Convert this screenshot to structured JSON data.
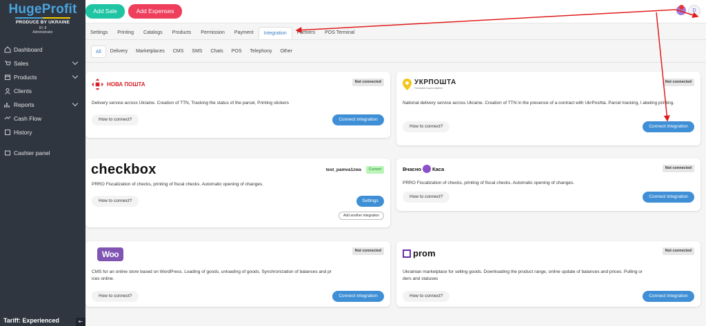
{
  "sidebar": {
    "logo": "HugeProfit",
    "tagline": "PRODUCE BY UKRAINE",
    "id": "ID: 8",
    "role": "Administrator",
    "items": [
      {
        "label": "Dashboard",
        "icon": "dashboard-icon"
      },
      {
        "label": "Sales",
        "icon": "sales-icon"
      },
      {
        "label": "Products",
        "icon": "products-icon"
      },
      {
        "label": "Clients",
        "icon": "clients-icon"
      },
      {
        "label": "Reports",
        "icon": "reports-icon"
      },
      {
        "label": "Cash Flow",
        "icon": "cash-flow-icon"
      },
      {
        "label": "History",
        "icon": "history-icon"
      },
      {
        "label": "Cashier panel",
        "icon": "cashier-icon"
      }
    ],
    "tariff": "Tariff: Experienced"
  },
  "topbar": {
    "add_sale": "Add Sale",
    "add_expenses": "Add Expenses",
    "user_initial": "D"
  },
  "tabs": [
    "Settings",
    "Printing",
    "Catalogs",
    "Products",
    "Permission",
    "Payment",
    "Integration",
    "Partners",
    "POS Terminal"
  ],
  "active_tab": "Integration",
  "subtabs": [
    "All",
    "Delivery",
    "Marketplaces",
    "CMS",
    "SMS",
    "Chats",
    "POS",
    "Telephony",
    "Other"
  ],
  "active_subtab": "All",
  "common": {
    "how_to": "How to connect?",
    "connect": "Connect integration",
    "not_connected": "Not connected"
  },
  "cards": {
    "nova": {
      "logo": "НОВА ПОШТА",
      "desc": "Delivery service across Ukraine. Creation of TTN, Tracking the status of the parcel, Printing stickers"
    },
    "ukr": {
      "logo": "УКРПОШТА",
      "logo_sub": "Головна пошта країни",
      "desc": "National delivery service across Ukraine. Creation of TTN in the presence of a contract with UkrPoshta. Parcel tracking, l abeling printing."
    },
    "checkbox": {
      "logo": "checkbox",
      "user": "test_pamva1zwa",
      "status": "Current",
      "settings": "Settings",
      "add_another": "Add another integration",
      "desc": "PRRO Fiscalization of checks, printing of fiscal checks. Automatic opening of changes."
    },
    "vchasno": {
      "logo_left": "Вчасно",
      "logo_right": "Каса",
      "desc": "PRRO Fiscalization of checks, printing of fiscal checks. Automatic opening of changes."
    },
    "woo": {
      "logo": "Woo",
      "desc_line1": "CMS for an online store based on WordPress. Loading of goods, unloading of goods. Synchronization of balances and pr",
      "desc_line2": "ices online."
    },
    "prom": {
      "logo": "prom",
      "desc_line1": "Ukrainian marketplace for selling goods. Downloading the product range, online update of balances and prices. Pulling or",
      "desc_line2": "ders and statuses"
    }
  }
}
